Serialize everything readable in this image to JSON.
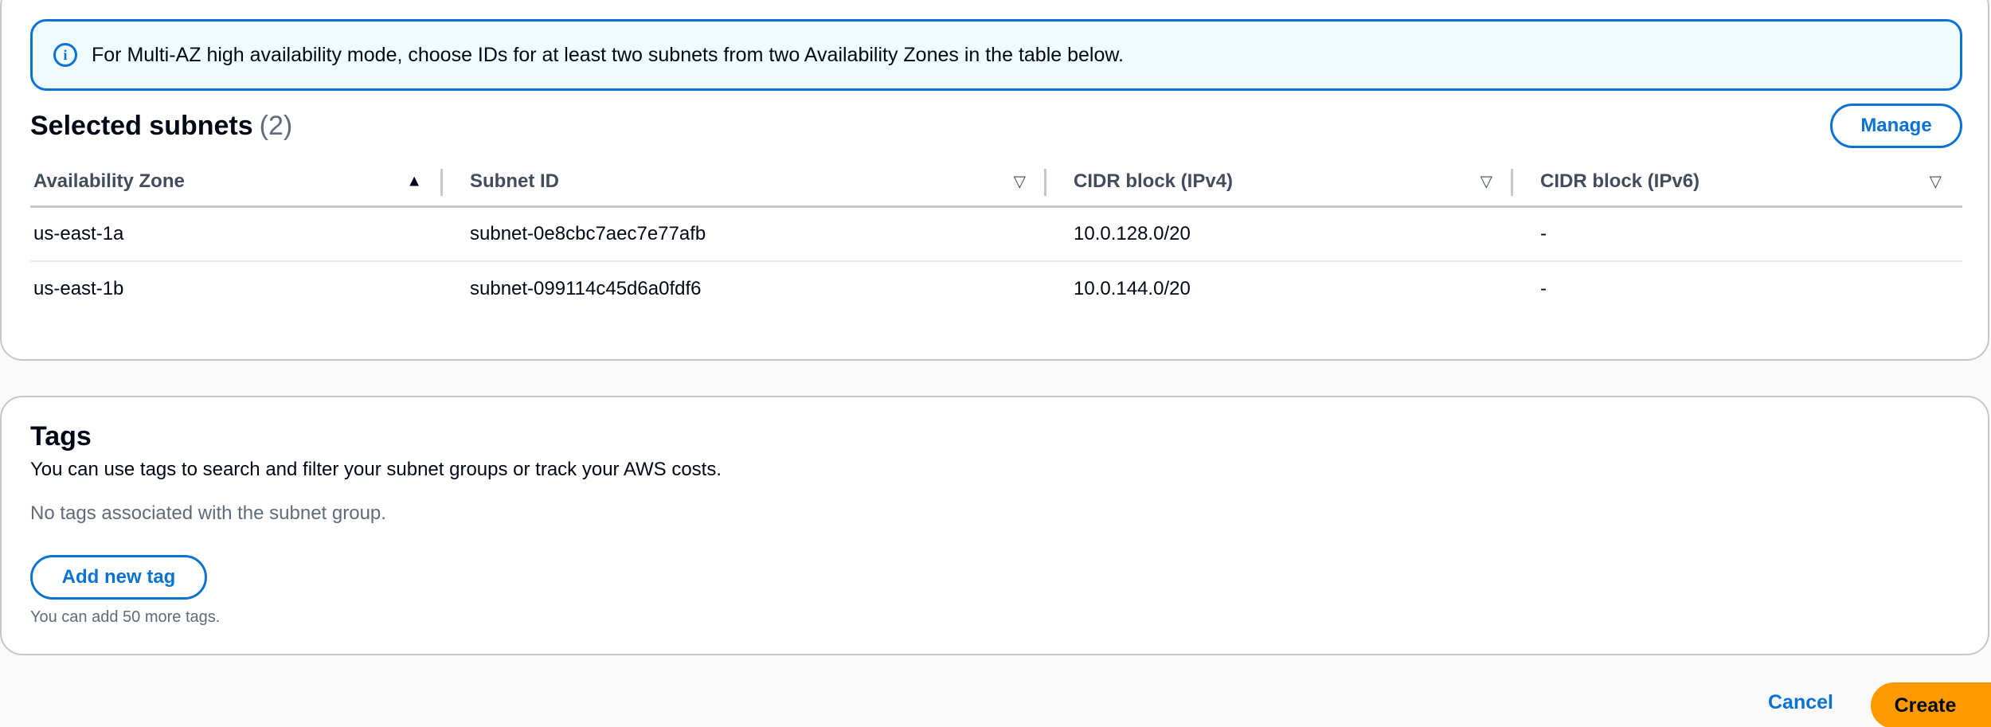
{
  "info_alert": {
    "icon": "info-icon",
    "text": "For Multi-AZ high availability mode, choose IDs for at least two subnets from two Availability Zones in the table below."
  },
  "selected_subnets": {
    "title": "Selected subnets",
    "count": "(2)",
    "manage_label": "Manage",
    "columns": [
      "Availability Zone",
      "Subnet ID",
      "CIDR block (IPv4)",
      "CIDR block (IPv6)"
    ],
    "rows": [
      [
        "us-east-1a",
        "subnet-0e8cbc7aec7e77afb",
        "10.0.128.0/20",
        "-"
      ],
      [
        "us-east-1b",
        "subnet-099114c45d6a0fdf6",
        "10.0.144.0/20",
        "-"
      ]
    ]
  },
  "tags": {
    "title": "Tags",
    "description": "You can use tags to search and filter your subnet groups or track your AWS costs.",
    "empty_text": "No tags associated with the subnet group.",
    "add_label": "Add new tag",
    "hint": "You can add 50 more tags."
  },
  "footer": {
    "cancel_label": "Cancel",
    "create_label": "Create"
  },
  "colors": {
    "accent": "#0972d3",
    "primary_button": "#ff9900",
    "info_background": "#f0fbff"
  }
}
